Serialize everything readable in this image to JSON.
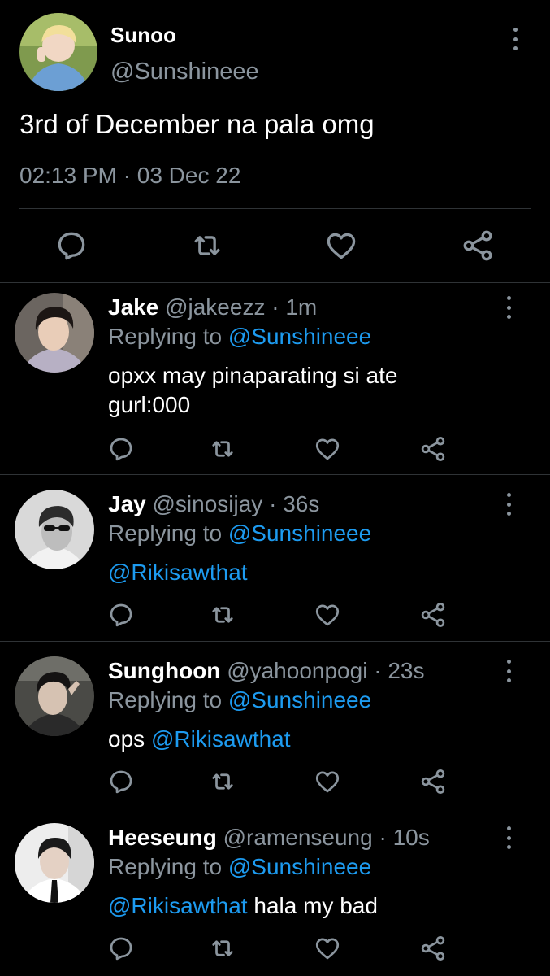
{
  "main_tweet": {
    "name": "Sunoo",
    "handle": "@Sunshineee",
    "text": "3rd of December na pala omg",
    "time": "02:13 PM",
    "date": "03 Dec 22",
    "separator": "·"
  },
  "replies": [
    {
      "name": "Jake",
      "handle": "@jakeezz",
      "age": "1m",
      "replying_prefix": "Replying to",
      "replying_to": "@Sunshineee",
      "body_text": "opxx may pinaparating si ate gurl:000"
    },
    {
      "name": "Jay",
      "handle": "@sinosijay",
      "age": "36s",
      "replying_prefix": "Replying to",
      "replying_to": "@Sunshineee",
      "body_mention": "@Rikisawthat"
    },
    {
      "name": "Sunghoon",
      "handle": "@yahoonpogi",
      "age": "23s",
      "replying_prefix": "Replying to",
      "replying_to": "@Sunshineee",
      "body_prefix": "ops",
      "body_mention": "@Rikisawthat"
    },
    {
      "name": "Heeseung",
      "handle": "@ramenseung",
      "age": "10s",
      "replying_prefix": "Replying to",
      "replying_to": "@Sunshineee",
      "body_mention": "@Rikisawthat",
      "body_suffix": "hala my bad"
    }
  ],
  "icons": [
    "reply-icon",
    "retweet-icon",
    "like-icon",
    "share-icon",
    "more-vertical-icon"
  ],
  "colors": {
    "background": "#000000",
    "text": "#ffffff",
    "muted": "#8b959e",
    "link": "#1d9bf0",
    "divider": "#2f3336"
  }
}
